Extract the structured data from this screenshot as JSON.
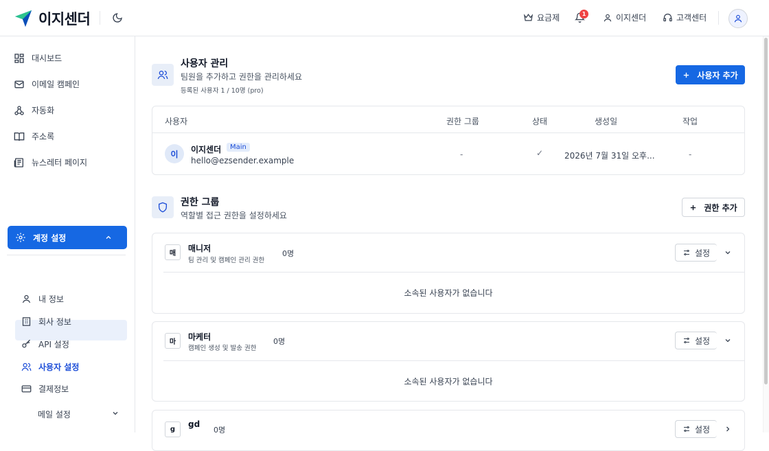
{
  "app": {
    "name": "이지센더"
  },
  "header": {
    "plan_label": "요금제",
    "notification_count": "1",
    "account_label": "이지센더",
    "support_label": "고객센터"
  },
  "sidebar": {
    "items": [
      {
        "label": "대시보드",
        "icon": "dashboard-icon"
      },
      {
        "label": "이메일 캠페인",
        "icon": "mail-icon"
      },
      {
        "label": "자동화",
        "icon": "workflow-icon"
      },
      {
        "label": "주소록",
        "icon": "book-icon"
      },
      {
        "label": "뉴스레터 페이지",
        "icon": "newspaper-icon"
      }
    ],
    "account_settings": {
      "label": "계정 설정",
      "sub_items": [
        {
          "label": "내 정보",
          "icon": "user-icon"
        },
        {
          "label": "회사 정보",
          "icon": "building-icon"
        },
        {
          "label": "API 설정",
          "icon": "key-icon"
        },
        {
          "label": "사용자 설정",
          "icon": "users-icon",
          "active": true
        },
        {
          "label": "결제정보",
          "icon": "card-icon"
        },
        {
          "label": "메일 설정",
          "icon": ""
        }
      ]
    }
  },
  "users_section": {
    "title": "사용자 관리",
    "subtitle": "팀원을 추가하고 권한을 관리하세요",
    "meta": "등록된 사용자 1 / 10명 (pro)",
    "add_button": "사용자 추가",
    "columns": [
      "사용자",
      "권한 그룹",
      "상태",
      "생성일",
      "작업"
    ],
    "rows": [
      {
        "avatar": "이",
        "name": "이지센더",
        "badge": "Main",
        "email": "hello@ezsender.example",
        "group": "-",
        "status": "✓",
        "created": "2026년 7월 31일 오후...",
        "action": "-"
      }
    ]
  },
  "groups_section": {
    "title": "권한 그룹",
    "subtitle": "역할별 접근 권한을 설정하세요",
    "add_button": "권한 추가",
    "setting_label": "설정",
    "groups": [
      {
        "initial": "매",
        "name": "매니저",
        "desc": "팀 관리 및 캠페인 관리 권한",
        "count": "0명",
        "empty": "소속된 사용자가 없습니다"
      },
      {
        "initial": "마",
        "name": "마케터",
        "desc": "캠페인 생성 및 발송 권한",
        "count": "0명",
        "empty": "소속된 사용자가 없습니다"
      },
      {
        "initial": "g",
        "name": "gd",
        "desc": "",
        "count": "0명",
        "empty": ""
      }
    ]
  },
  "colors": {
    "primary": "#1668e3",
    "badge_red": "#ef4444",
    "active_bg": "#eaf0fb"
  }
}
